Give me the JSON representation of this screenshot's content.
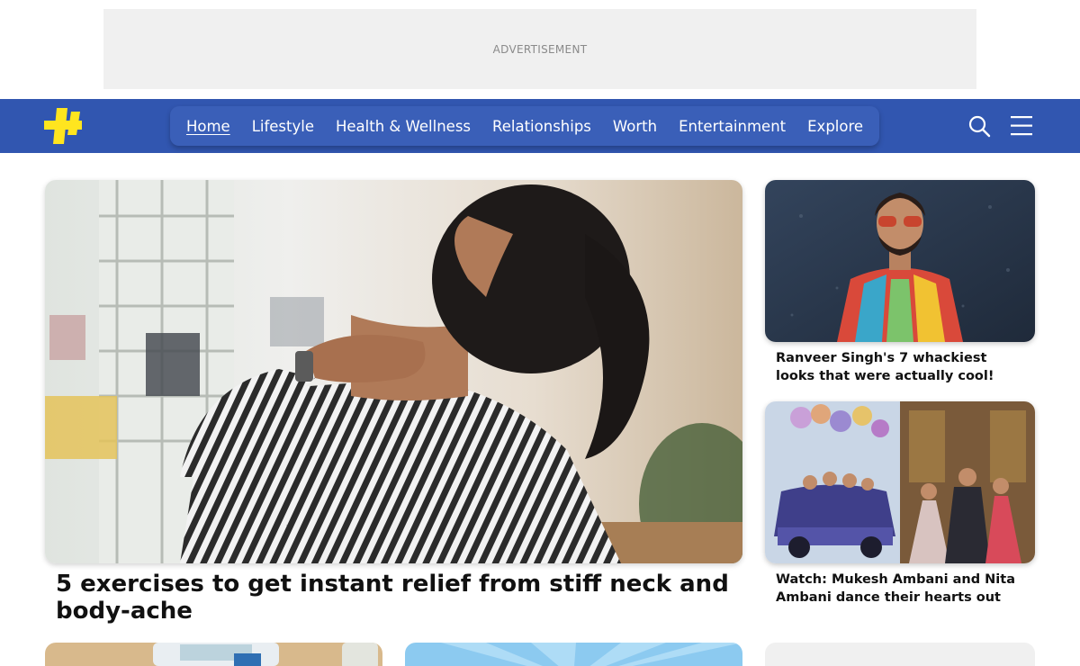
{
  "ad": {
    "label": "ADVERTISEMENT"
  },
  "nav": {
    "logo_icon": "plus-logo-icon",
    "brand_color": "#3156b0",
    "logo_color": "#ffe51f",
    "items": [
      {
        "label": "Home",
        "active": true
      },
      {
        "label": "Lifestyle"
      },
      {
        "label": "Health & Wellness"
      },
      {
        "label": "Relationships"
      },
      {
        "label": "Worth"
      },
      {
        "label": "Entertainment"
      },
      {
        "label": "Explore"
      }
    ],
    "search_icon": "search-icon",
    "menu_icon": "hamburger-menu-icon"
  },
  "hero": {
    "title": "5 exercises to get instant relief from stiff neck and body-ache"
  },
  "side_articles": [
    {
      "title": "Ranveer Singh's 7 whackiest looks that were actually cool!"
    },
    {
      "title": "Watch: Mukesh Ambani and Nita Ambani dance their hearts out"
    }
  ]
}
